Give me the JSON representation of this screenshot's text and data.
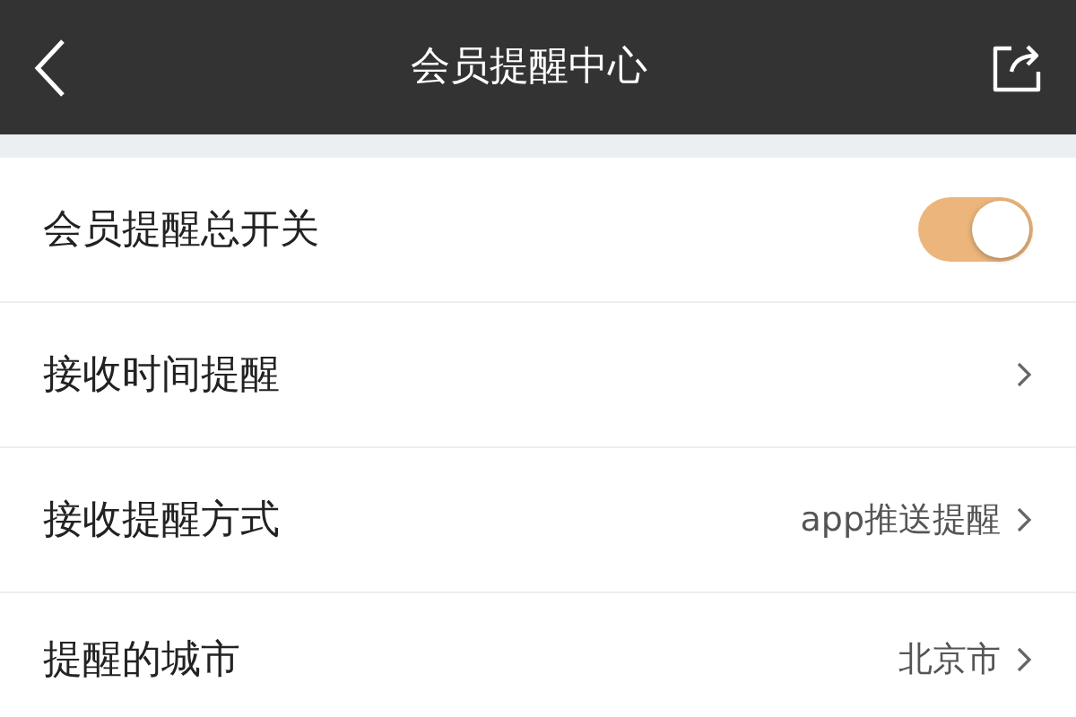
{
  "header": {
    "title": "会员提醒中心"
  },
  "settings": [
    {
      "kind": "toggle",
      "label": "会员提醒总开关",
      "on": true
    },
    {
      "kind": "link",
      "label": "接收时间提醒"
    },
    {
      "kind": "link",
      "label": "接收提醒方式",
      "value": "app推送提醒"
    },
    {
      "kind": "link",
      "label": "提醒的城市",
      "value": "北京市"
    }
  ]
}
